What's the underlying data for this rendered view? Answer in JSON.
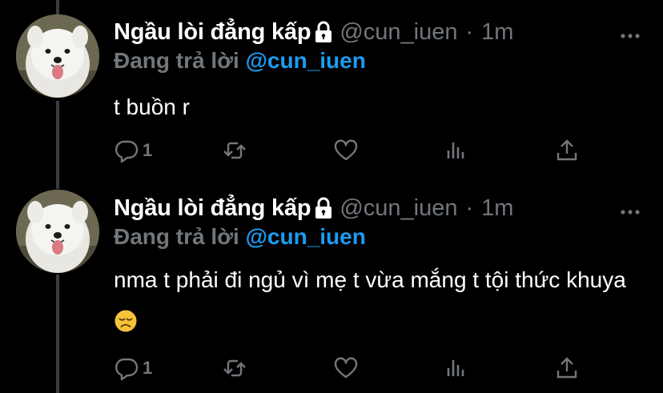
{
  "tweets": [
    {
      "display_name": "Ngầu lòi đẳng kấp",
      "handle": "@cun_iuen",
      "separator": "·",
      "time": "1m",
      "reply_prefix": "Đang trả lời",
      "reply_to": "@cun_iuen",
      "text": "t buồn r",
      "reply_count": "1",
      "emoji": ""
    },
    {
      "display_name": "Ngầu lòi đẳng kấp",
      "handle": "@cun_iuen",
      "separator": "·",
      "time": "1m",
      "reply_prefix": "Đang trả lời",
      "reply_to": "@cun_iuen",
      "text": "nma t phải đi ngủ vì mẹ t vừa mắng t tội thức khuya",
      "reply_count": "1",
      "emoji": "disappointed-face"
    }
  ],
  "icons": [
    "lock-icon",
    "more-icon",
    "reply-icon",
    "retweet-icon",
    "like-icon",
    "stats-icon",
    "share-icon"
  ],
  "colors": {
    "background": "#000000",
    "name": "#ffffff",
    "secondary": "#71767b",
    "link": "#1d9bf0",
    "thread_line": "#3a3d41"
  }
}
